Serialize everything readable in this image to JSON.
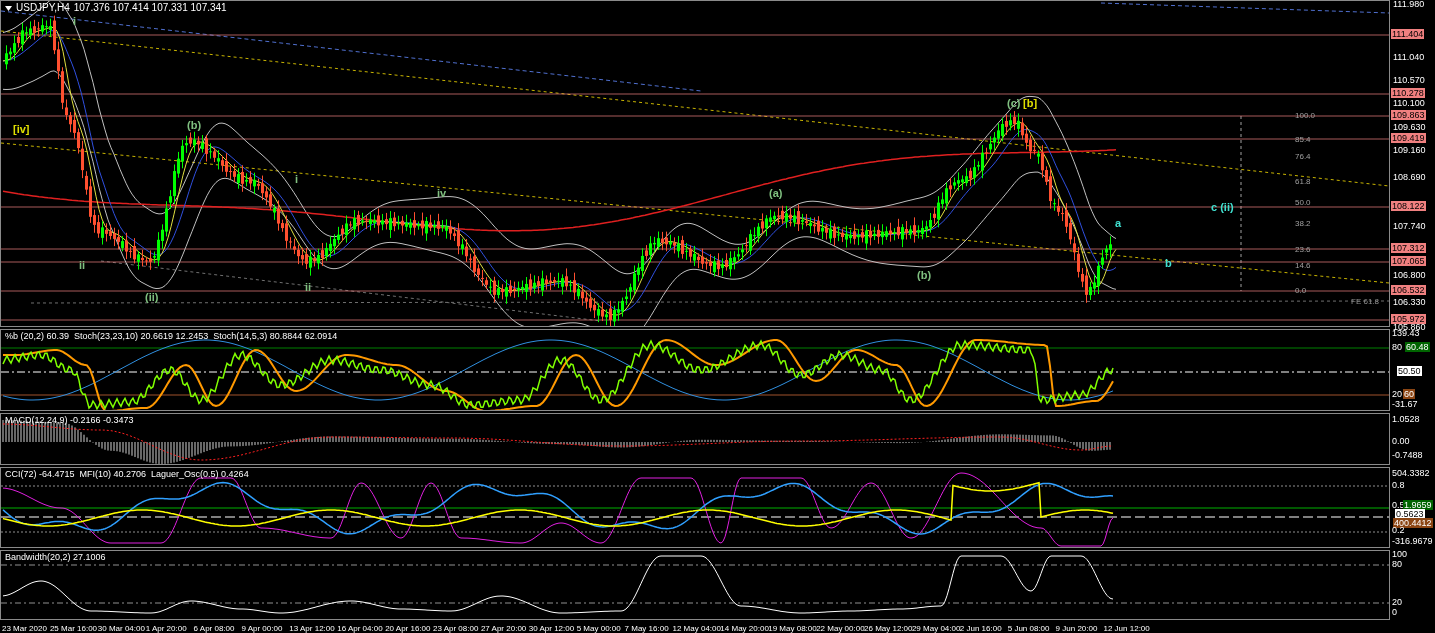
{
  "chart": {
    "symbol": "USDJPY,H4",
    "quote": "107.376 107.414 107.331 107.341",
    "price_ticks": [
      "111.980",
      "111.040",
      "110.570",
      "110.100",
      "109.630",
      "109.160",
      "108.690",
      "107.740",
      "106.800",
      "106.330",
      "105.860"
    ],
    "price_levels": [
      {
        "text": "111.404",
        "color": "#f08080"
      },
      {
        "text": "110.278",
        "color": "#f08080"
      },
      {
        "text": "109.863",
        "color": "#f08080"
      },
      {
        "text": "109.419",
        "color": "#f08080"
      },
      {
        "text": "108.122",
        "color": "#f08080"
      },
      {
        "text": "107.312",
        "color": "#f08080"
      },
      {
        "text": "107.065",
        "color": "#f08080"
      },
      {
        "text": "106.532",
        "color": "#f08080"
      },
      {
        "text": "105.972",
        "color": "#f08080"
      }
    ],
    "wave_labels": [
      {
        "text": "i",
        "color": "#80c080"
      },
      {
        "text": "[iv]",
        "color": "#e0e000"
      },
      {
        "text": "(b)",
        "color": "#80c080"
      },
      {
        "text": "ii",
        "color": "#80c080"
      },
      {
        "text": "(ii)",
        "color": "#80c080"
      },
      {
        "text": "i",
        "color": "#80c080"
      },
      {
        "text": "ii",
        "color": "#80c080"
      },
      {
        "text": "iv",
        "color": "#80c080"
      },
      {
        "text": "(a)",
        "color": "#80c080"
      },
      {
        "text": "(b)",
        "color": "#80c080"
      },
      {
        "text": "(c)",
        "color": "#80c080"
      },
      {
        "text": "[b]",
        "color": "#e0e000"
      },
      {
        "text": "c (ii)",
        "color": "#40e0d0"
      },
      {
        "text": "a",
        "color": "#40e0d0"
      },
      {
        "text": "b",
        "color": "#40e0d0"
      }
    ],
    "fib_levels": [
      "100.0",
      "85.4",
      "76.4",
      "61.8",
      "50.0",
      "38.2",
      "23.6",
      "14.6",
      "0.0"
    ],
    "fe_label": "FE 61.8"
  },
  "indicators": [
    {
      "kind": "stoch",
      "header": "%b (20,2) 60.39  Stoch(23,23,10) 20.6619 12.2453  Stoch(14,5,3) 80.8844 62.0914",
      "axis": [
        {
          "text": "139.43"
        },
        {
          "text": "80"
        },
        {
          "text": "60.48",
          "color": "#006400"
        },
        {
          "text": "50.50",
          "color": "#ffffff"
        },
        {
          "text": "20"
        },
        {
          "text": "60",
          "color": "#8b4513"
        },
        {
          "text": "-31.67"
        }
      ]
    },
    {
      "kind": "macd",
      "header": "MACD(12,24,9) -0.2166 -0.3473",
      "axis": [
        {
          "text": "1.0528"
        },
        {
          "text": "0.00"
        },
        {
          "text": "-0.7488"
        }
      ]
    },
    {
      "kind": "cci",
      "header": "CCI(72) -64.4715  MFI(10) 40.2706  Laguer_Osc(0.5) 0.4264",
      "axis": [
        {
          "text": "504.3382"
        },
        {
          "text": "0.8"
        },
        {
          "text": "0.5"
        },
        {
          "text": "1.9659",
          "color": "#006400"
        },
        {
          "text": "0.5623",
          "color": "#ffffff"
        },
        {
          "text": "400.4412",
          "color": "#8b4513"
        },
        {
          "text": "0.2"
        },
        {
          "text": "-316.9679"
        }
      ]
    },
    {
      "kind": "bandwidth",
      "header": "Bandwidth(20,2) 27.1006",
      "axis": [
        {
          "text": "100"
        },
        {
          "text": "80"
        },
        {
          "text": "20"
        },
        {
          "text": "0"
        }
      ]
    }
  ],
  "time_axis": [
    "23 Mar 2020",
    "25 Mar 16:00",
    "30 Mar 04:00",
    "1 Apr 20:00",
    "6 Apr 08:00",
    "9 Apr 00:00",
    "13 Apr 12:00",
    "16 Apr 04:00",
    "20 Apr 16:00",
    "23 Apr 08:00",
    "27 Apr 20:00",
    "30 Apr 12:00",
    "5 May 00:00",
    "7 May 16:00",
    "12 May 04:00",
    "14 May 20:00",
    "19 May 08:00",
    "22 May 00:00",
    "26 May 12:00",
    "29 May 04:00",
    "2 Jun 16:00",
    "5 Jun 08:00",
    "9 Jun 20:00",
    "12 Jun 12:00"
  ]
}
